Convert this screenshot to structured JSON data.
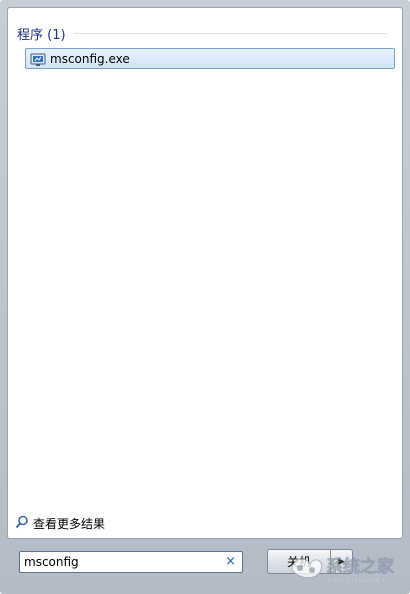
{
  "results": {
    "group_title": "程序 (1)",
    "items": [
      {
        "label": "msconfig.exe",
        "icon": "system-config-icon"
      }
    ]
  },
  "see_more": {
    "label": "查看更多结果",
    "icon": "search-icon"
  },
  "search": {
    "value": "msconfig",
    "clear_icon": "×",
    "clear_icon_name": "clear-icon"
  },
  "shutdown": {
    "label": "关机",
    "arrow_icon": "chevron-right-icon"
  },
  "watermark": {
    "text": "系统之家",
    "subtext": "XITONGZHIJIA.NET"
  },
  "colors": {
    "accent": "#1e3287",
    "selection_bg": "#dce9f8",
    "selection_border": "#7da2ce"
  }
}
